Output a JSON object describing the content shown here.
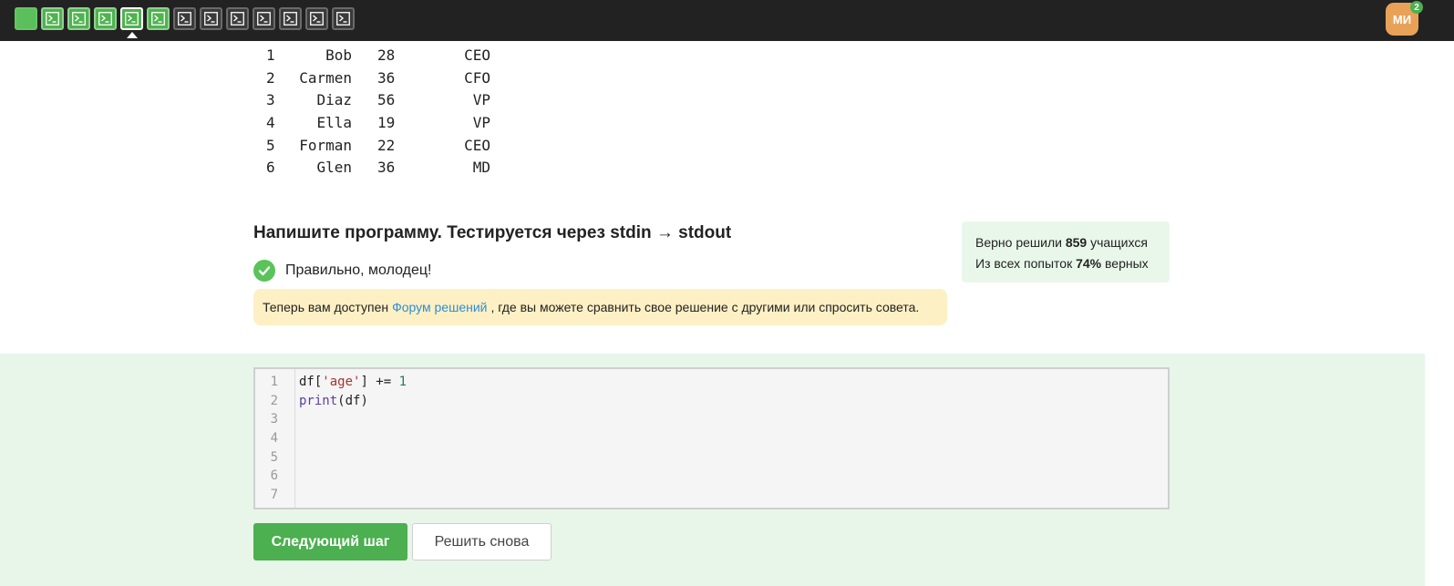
{
  "topbar": {
    "steps": [
      {
        "state": "first",
        "icon": "blank"
      },
      {
        "state": "solved",
        "icon": "terminal-icon"
      },
      {
        "state": "solved",
        "icon": "terminal-icon"
      },
      {
        "state": "solved",
        "icon": "terminal-icon"
      },
      {
        "state": "current",
        "icon": "terminal-icon"
      },
      {
        "state": "solved",
        "icon": "terminal-icon"
      },
      {
        "state": "todo",
        "icon": "terminal-icon"
      },
      {
        "state": "todo",
        "icon": "terminal-icon"
      },
      {
        "state": "todo",
        "icon": "terminal-icon"
      },
      {
        "state": "todo",
        "icon": "terminal-icon"
      },
      {
        "state": "todo",
        "icon": "terminal-icon"
      },
      {
        "state": "todo",
        "icon": "terminal-icon"
      },
      {
        "state": "todo",
        "icon": "terminal-icon"
      }
    ],
    "avatar_initials": "МИ",
    "notifications_count": "2"
  },
  "output_table": {
    "rows": [
      {
        "index": "1",
        "name": "Bob",
        "age": "28",
        "position": "CEO"
      },
      {
        "index": "2",
        "name": "Carmen",
        "age": "36",
        "position": "CFO"
      },
      {
        "index": "3",
        "name": "Diaz",
        "age": "56",
        "position": "VP"
      },
      {
        "index": "4",
        "name": "Ella",
        "age": "19",
        "position": "VP"
      },
      {
        "index": "5",
        "name": "Forman",
        "age": "22",
        "position": "CEO"
      },
      {
        "index": "6",
        "name": "Glen",
        "age": "36",
        "position": "MD"
      }
    ]
  },
  "task": {
    "title": "Напишите программу. Тестируется через stdin → stdout",
    "status_text": "Правильно, молодец!",
    "notice_before": "Теперь вам доступен",
    "notice_link": "Форум решений",
    "notice_after": ", где вы можете сравнить свое решение с другими или спросить совета."
  },
  "stats": {
    "line1_prefix": "Верно решили",
    "line1_value": "859",
    "line1_suffix": "учащихся",
    "line2_prefix": "Из всех попыток",
    "line2_value": "74%",
    "line2_suffix": "верных"
  },
  "editor": {
    "line_numbers": [
      "1",
      "2",
      "3",
      "4",
      "5",
      "6",
      "7"
    ],
    "code_line1": {
      "a": "df[",
      "b": "'age'",
      "c": "] += ",
      "d": "1"
    },
    "code_line2": {
      "a": "print",
      "b": "(df)"
    }
  },
  "buttons": {
    "next_label": "Следующий шаг",
    "retry_label": "Решить снова"
  },
  "colors": {
    "accent_green": "#4caf50",
    "topbar_bg": "#222222",
    "notice_bg": "#fdf0c4",
    "stats_bg": "#e9f7ea",
    "link": "#2d8fd5"
  }
}
